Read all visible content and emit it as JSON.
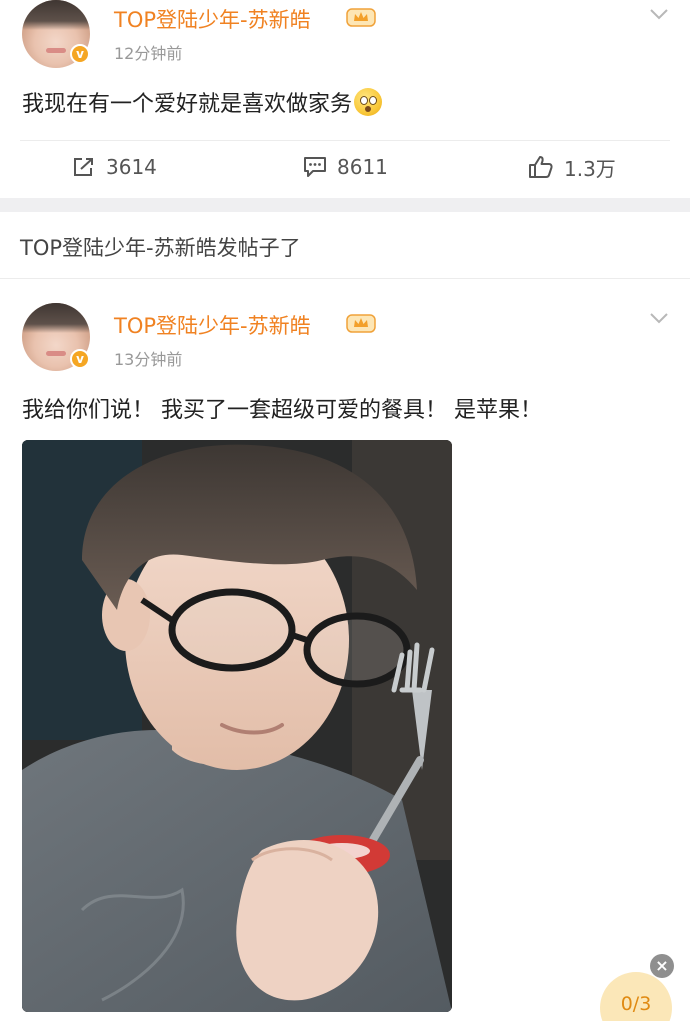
{
  "posts": [
    {
      "username": "TOP登陆少年-苏新皓",
      "time": "12分钟前",
      "text": "我现在有一个爱好就是喜欢做家务",
      "emoji": "astonished-face-emoji",
      "stats": {
        "repost": "3614",
        "comment": "8611",
        "like": "1.3万"
      }
    },
    {
      "username": "TOP登陆少年-苏新皓",
      "time": "13分钟前",
      "text": "我给你们说！ 我买了一套超级可爱的餐具！ 是苹果！"
    }
  ],
  "repost_note": "TOP登陆少年-苏新皓发帖子了",
  "badge_letter": "v",
  "pager": {
    "label": "0/3"
  },
  "close_glyph": "×",
  "colors": {
    "username": "#f08222",
    "badge": "#f5a623",
    "pager_bg": "#fbe7b8",
    "pager_text": "#e08a12"
  },
  "icons": [
    "crown-badge-icon",
    "chevron-down-icon",
    "repost-icon",
    "comment-icon",
    "like-icon",
    "close-icon"
  ]
}
